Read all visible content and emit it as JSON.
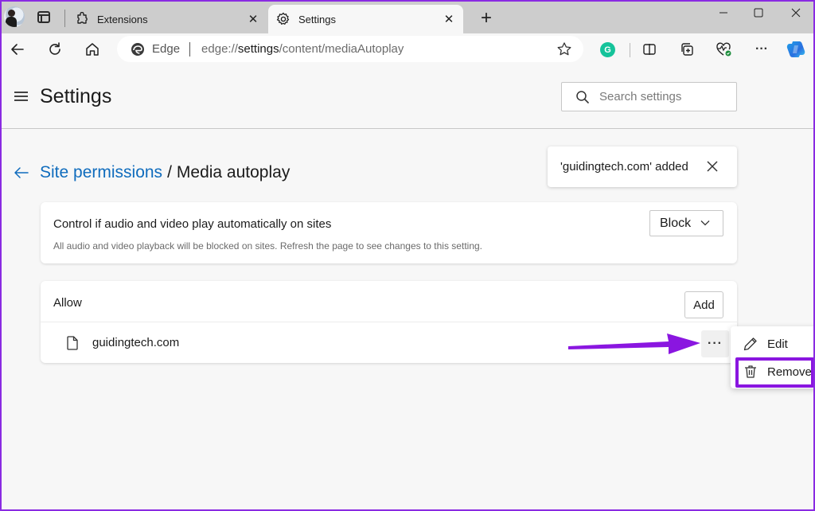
{
  "browser": {
    "tabs": [
      {
        "title": "Extensions",
        "icon": "puzzle-icon",
        "active": false
      },
      {
        "title": "Settings",
        "icon": "gear-icon",
        "active": true
      }
    ],
    "address_bar": {
      "site_label": "Edge",
      "url_prefix": "edge://",
      "url_host": "settings",
      "url_path": "/content/mediaAutoplay"
    },
    "toolbar_icons": [
      "back-arrow-icon",
      "refresh-icon",
      "home-icon",
      "favorite-star-icon",
      "grammarly-icon",
      "split-screen-icon",
      "collections-icon",
      "browser-essentials-icon",
      "more-icon",
      "copilot-icon"
    ],
    "grammarly_glyph": "G",
    "more_glyph": "···"
  },
  "settings": {
    "title": "Settings",
    "search": {
      "placeholder": "Search settings",
      "value": ""
    },
    "breadcrumb": {
      "parent": "Site permissions",
      "separator": "/",
      "current": "Media autoplay"
    },
    "toast": {
      "message": "'guidingtech.com' added"
    },
    "autoplay": {
      "title": "Control if audio and video play automatically on sites",
      "description": "All audio and video playback will be blocked on sites. Refresh the page to see changes to this setting.",
      "selected": "Block"
    },
    "allow": {
      "title": "Allow",
      "add_label": "Add",
      "sites": [
        {
          "name": "guidingtech.com"
        }
      ],
      "more_glyph": "···"
    },
    "context_menu": {
      "items": [
        {
          "label": "Edit",
          "icon": "pencil-icon"
        },
        {
          "label": "Remove",
          "icon": "trash-icon",
          "highlighted": true
        }
      ]
    }
  },
  "colors": {
    "accent_link": "#0f6cbd",
    "annotation": "#8a16e0",
    "grammarly": "#15c39a"
  }
}
